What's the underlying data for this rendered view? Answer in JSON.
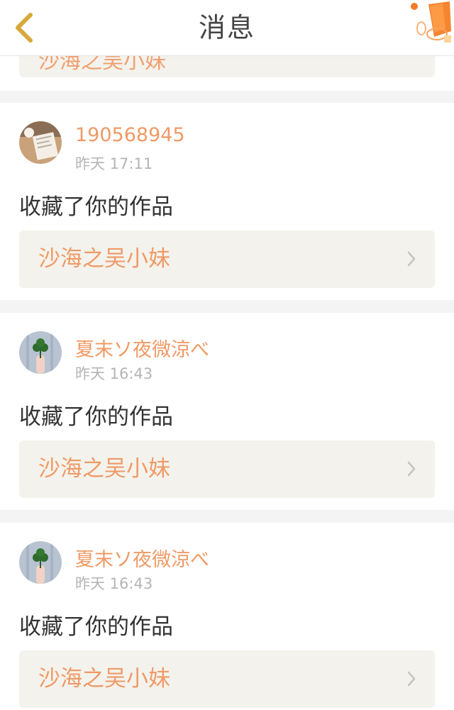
{
  "header": {
    "title": "消息",
    "back_icon": "chevron-left-icon",
    "decoration_icon": "sky-lantern-icon"
  },
  "colors": {
    "accent": "#ef9a66",
    "back_arrow": "#d8a93a",
    "text_primary": "#333333",
    "text_secondary": "#b5b5b5",
    "work_box_bg": "#f4f2ec",
    "divider_bg": "#f4f4f4"
  },
  "partial_card": {
    "work_title": "沙海之吴小妹"
  },
  "messages": [
    {
      "username": "190568945",
      "time": "昨天 17:11",
      "action": "收藏了你的作品",
      "work_title": "沙海之吴小妹",
      "avatar": "book-photo-avatar"
    },
    {
      "username": "夏末ソ夜微涼べ",
      "time": "昨天 16:43",
      "action": "收藏了你的作品",
      "work_title": "沙海之吴小妹",
      "avatar": "clover-hand-avatar"
    },
    {
      "username": "夏末ソ夜微涼べ",
      "time": "昨天 16:43",
      "action": "收藏了你的作品",
      "work_title": "沙海之吴小妹",
      "avatar": "clover-hand-avatar"
    }
  ]
}
